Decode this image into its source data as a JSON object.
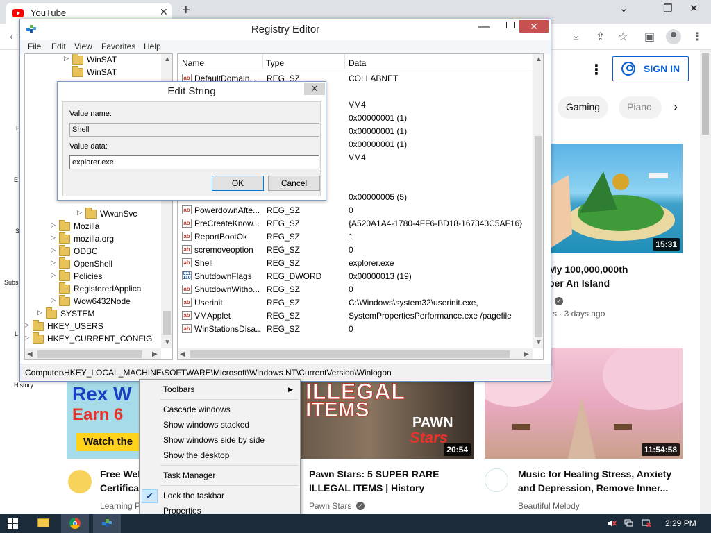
{
  "browser": {
    "tab_title": "YouTube",
    "tab_close": "✕",
    "new_tab": "+",
    "minimize": "⌄",
    "restore": "❐",
    "close": "✕",
    "back": "←"
  },
  "youtube": {
    "sign_in": "SIGN IN",
    "chips": [
      "Gaming",
      "Pianc"
    ],
    "sidebar_labels": [
      "H",
      "E",
      "S",
      "Subs",
      "L",
      "History"
    ],
    "videos": [
      {
        "title_line1": "My 100,000,000th",
        "title_line2": "ber An Island",
        "meta": "s · 3 days ago",
        "duration": "15:31"
      },
      {
        "title_line1": "Free Web",
        "title_line2": "Certificat",
        "channel": "Learning P",
        "thumb_text1": "Rex W",
        "thumb_text2": "Earn 6",
        "thumb_text3": "Watch the"
      },
      {
        "title_line1": "Pawn Stars: 5 SUPER RARE",
        "title_line2": "ILLEGAL ITEMS | History",
        "channel": "Pawn Stars",
        "duration": "20:54",
        "thumb_text1": "ILLEGAL",
        "thumb_text2": "ITEMS",
        "thumb_text3": "PAWN",
        "thumb_text4": "Stars"
      },
      {
        "title_line1": "Music for Healing Stress, Anxiety",
        "title_line2": "and Depression, Remove Inner...",
        "channel": "Beautiful Melody",
        "duration": "11:54:58"
      }
    ]
  },
  "regedit": {
    "title": "Registry Editor",
    "menu": [
      "File",
      "Edit",
      "View",
      "Favorites",
      "Help"
    ],
    "tree": [
      {
        "label": "WinSAT",
        "indent": 2,
        "expander": "▷"
      },
      {
        "label": "WinSAT",
        "indent": 2,
        "expander": ""
      },
      {
        "label": "WwanSvc",
        "indent": 3,
        "expander": "▷"
      },
      {
        "label": "Mozilla",
        "indent": 1,
        "expander": "▷"
      },
      {
        "label": "mozilla.org",
        "indent": 1,
        "expander": "▷"
      },
      {
        "label": "ODBC",
        "indent": 1,
        "expander": "▷"
      },
      {
        "label": "OpenShell",
        "indent": 1,
        "expander": "▷"
      },
      {
        "label": "Policies",
        "indent": 1,
        "expander": "▷"
      },
      {
        "label": "RegisteredApplica",
        "indent": 1,
        "expander": ""
      },
      {
        "label": "Wow6432Node",
        "indent": 1,
        "expander": "▷"
      },
      {
        "label": "SYSTEM",
        "indent": 0,
        "expander": "▷"
      },
      {
        "label": "HKEY_USERS",
        "indent": -1,
        "expander": "▷"
      },
      {
        "label": "HKEY_CURRENT_CONFIG",
        "indent": -1,
        "expander": "▷"
      }
    ],
    "columns": {
      "name": "Name",
      "type": "Type",
      "data": "Data"
    },
    "rows": [
      {
        "name": "DefaultDomain...",
        "type": "REG_SZ",
        "data": "COLLABNET",
        "kind": "sz"
      },
      {
        "name": "",
        "type": "",
        "data": "VM4",
        "kind": ""
      },
      {
        "name": "",
        "type": "",
        "data": "0x00000001 (1)",
        "kind": ""
      },
      {
        "name": "",
        "type": "",
        "data": "0x00000001 (1)",
        "kind": ""
      },
      {
        "name": "",
        "type": "",
        "data": "0x00000001 (1)",
        "kind": ""
      },
      {
        "name": "",
        "type": "",
        "data": "VM4",
        "kind": ""
      },
      {
        "name": "",
        "type": "",
        "data": "0x00000005 (5)",
        "kind": ""
      },
      {
        "name": "PowerdownAfte...",
        "type": "REG_SZ",
        "data": "0",
        "kind": "sz"
      },
      {
        "name": "PreCreateKnow...",
        "type": "REG_SZ",
        "data": "{A520A1A4-1780-4FF6-BD18-167343C5AF16}",
        "kind": "sz"
      },
      {
        "name": "ReportBootOk",
        "type": "REG_SZ",
        "data": "1",
        "kind": "sz"
      },
      {
        "name": "scremoveoption",
        "type": "REG_SZ",
        "data": "0",
        "kind": "sz"
      },
      {
        "name": "Shell",
        "type": "REG_SZ",
        "data": "explorer.exe",
        "kind": "sz"
      },
      {
        "name": "ShutdownFlags",
        "type": "REG_DWORD",
        "data": "0x00000013 (19)",
        "kind": "dword"
      },
      {
        "name": "ShutdownWitho...",
        "type": "REG_SZ",
        "data": "0",
        "kind": "sz"
      },
      {
        "name": "Userinit",
        "type": "REG_SZ",
        "data": "C:\\Windows\\system32\\userinit.exe,",
        "kind": "sz"
      },
      {
        "name": "VMApplet",
        "type": "REG_SZ",
        "data": "SystemPropertiesPerformance.exe /pagefile",
        "kind": "sz"
      },
      {
        "name": "WinStationsDisa...",
        "type": "REG_SZ",
        "data": "0",
        "kind": "sz"
      }
    ],
    "status_path": "Computer\\HKEY_LOCAL_MACHINE\\SOFTWARE\\Microsoft\\Windows NT\\CurrentVersion\\Winlogon"
  },
  "edit_string": {
    "title": "Edit String",
    "close": "✕",
    "value_name_label": "Value name:",
    "value_name": "Shell",
    "value_data_label": "Value data:",
    "value_data": "explorer.exe",
    "ok": "OK",
    "cancel": "Cancel"
  },
  "context_menu": {
    "toolbars": "Toolbars",
    "cascade": "Cascade windows",
    "stacked": "Show windows stacked",
    "side_by_side": "Show windows side by side",
    "desktop": "Show the desktop",
    "task_manager": "Task Manager",
    "lock": "Lock the taskbar",
    "lock_checked": "✔",
    "properties": "Properties",
    "submenu_arrow": "▶"
  },
  "taskbar": {
    "clock": "2:29 PM"
  }
}
